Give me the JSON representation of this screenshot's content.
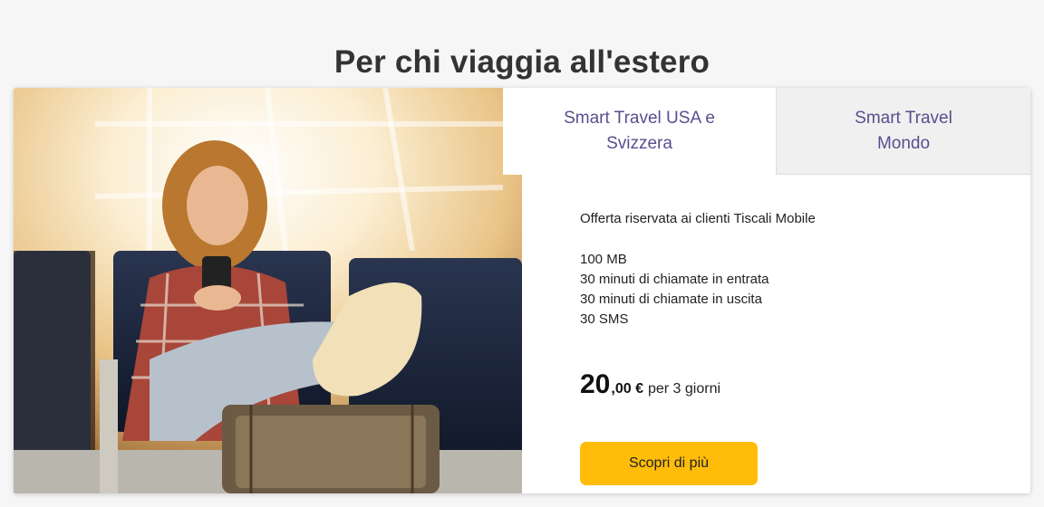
{
  "page": {
    "title": "Per chi viaggia all'estero"
  },
  "tabs": [
    {
      "label": "Smart Travel USA e Svizzera",
      "active": true
    },
    {
      "label": "Smart Travel Mondo",
      "active": false
    }
  ],
  "offer": {
    "intro": "Offerta riservata ai clienti Tiscali Mobile",
    "features": [
      "100 MB",
      "30 minuti di chiamate in entrata",
      "30 minuti di chiamate in uscita",
      "30 SMS"
    ],
    "price_int": "20",
    "price_dec": ",00 €",
    "price_period": "per 3 giorni",
    "cta_label": "Scopri di più"
  },
  "image": {
    "subject": "traveler-with-phone-and-suitcase"
  },
  "colors": {
    "tab_text": "#5a4e8f",
    "cta_bg": "#ffbd0a",
    "inactive_tab_bg": "#f0f0f0"
  }
}
